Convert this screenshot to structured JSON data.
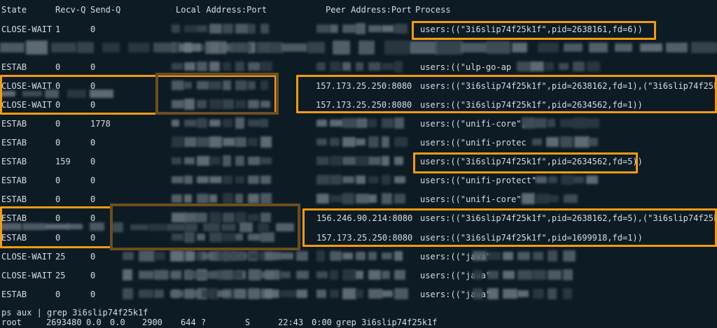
{
  "header": {
    "state": "State",
    "recvq": "Recv-Q",
    "sendq": "Send-Q",
    "local": "Local Address:Port",
    "peer": "Peer Address:Port",
    "process": "Process"
  },
  "rows": [
    {
      "state": "CLOSE-WAIT",
      "recvq": "1",
      "sendq": "0",
      "peer": "",
      "process": "users:((\"3i6slip74f25k1f\",pid=2638161,fd=6))"
    },
    {
      "state": "",
      "recvq": "",
      "sendq": "",
      "peer": "",
      "process": ""
    },
    {
      "state": "ESTAB",
      "recvq": "0",
      "sendq": "0",
      "peer": "",
      "process": "users:((\"ulp-go-ap"
    },
    {
      "state": "CLOSE-WAIT",
      "recvq": "0",
      "sendq": "0",
      "peer": "157.173.25.250:8080",
      "process": "users:((\"3i6slip74f25k1f\",pid=2638162,fd=1),(\"3i6slip74f25k"
    },
    {
      "state": "CLOSE-WAIT",
      "recvq": "0",
      "sendq": "0",
      "peer": "157.173.25.250:8080",
      "process": "users:((\"3i6slip74f25k1f\",pid=2634562,fd=1))"
    },
    {
      "state": "ESTAB",
      "recvq": "0",
      "sendq": "1778",
      "peer": "",
      "process": "users:((\"unifi-core\","
    },
    {
      "state": "ESTAB",
      "recvq": "0",
      "sendq": "0",
      "peer": "",
      "process": "users:((\"unifi-protec"
    },
    {
      "state": "ESTAB",
      "recvq": "159",
      "sendq": "0",
      "peer": "",
      "process": "users:((\"3i6slip74f25k1f\",pid=2634562,fd=5))"
    },
    {
      "state": "ESTAB",
      "recvq": "0",
      "sendq": "0",
      "peer": "",
      "process": "users:((\"unifi-protect\""
    },
    {
      "state": "ESTAB",
      "recvq": "0",
      "sendq": "0",
      "peer": "",
      "process": "users:((\"unifi-core\""
    },
    {
      "state": "ESTAB",
      "recvq": "0",
      "sendq": "0",
      "peer": "156.246.90.214:8080",
      "process": "users:((\"3i6slip74f25k1f\",pid=2638162,fd=5),(\"3i6slip74f25k"
    },
    {
      "state": "ESTAB",
      "recvq": "0",
      "sendq": "0",
      "peer": "157.173.25.250:8080",
      "process": "users:((\"3i6slip74f25k1f\",pid=1699918,fd=1))"
    },
    {
      "state": "CLOSE-WAIT",
      "recvq": "25",
      "sendq": "0",
      "peer": "",
      "process": "users:((\"java\""
    },
    {
      "state": "CLOSE-WAIT",
      "recvq": "25",
      "sendq": "0",
      "peer": "",
      "process": "users:((\"java\""
    },
    {
      "state": "ESTAB",
      "recvq": "0",
      "sendq": "0",
      "peer": "",
      "process": "users:((\"java\""
    }
  ],
  "command": {
    "line": "ps aux | grep 3i6slip74f25k1f",
    "user": "root",
    "pid": "2693480",
    "cpu": "0.0",
    "mem": "0.0",
    "vsz": "2900",
    "rss": "644",
    "tty": "?",
    "stat": "S",
    "start": "22:43",
    "time": "0:00",
    "cmd": "grep 3i6slip74f25k1f"
  },
  "colors": {
    "background": "#0d1b24",
    "text": "#d6dde2",
    "highlight": "#f59a12"
  }
}
